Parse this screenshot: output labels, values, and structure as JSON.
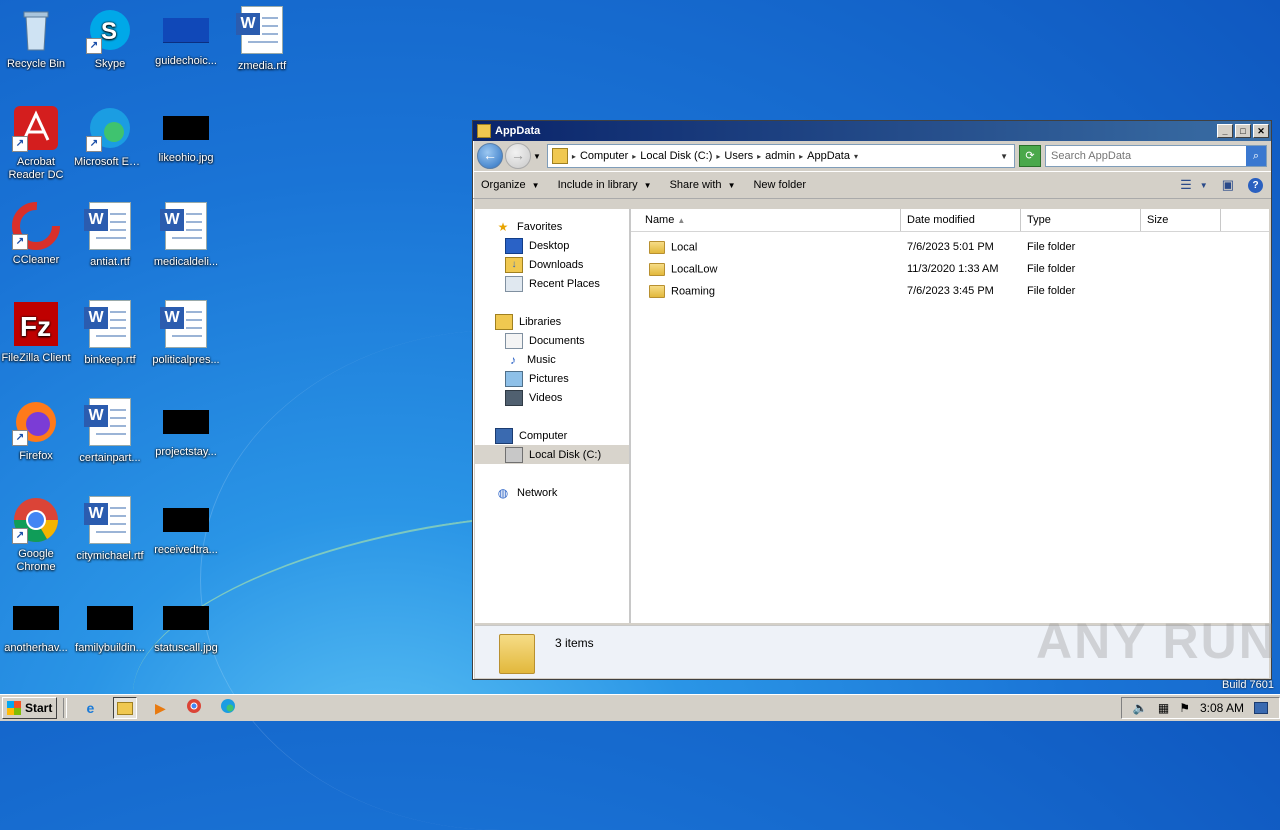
{
  "desktop": {
    "icons": [
      {
        "label": "Recycle Bin"
      },
      {
        "label": "Skype"
      },
      {
        "label": "guidechoic..."
      },
      {
        "label": "zmedia.rtf"
      },
      {
        "label": "Acrobat Reader DC"
      },
      {
        "label": "Microsoft Edge"
      },
      {
        "label": "likeohio.jpg"
      },
      {
        "label": "CCleaner"
      },
      {
        "label": "antiat.rtf"
      },
      {
        "label": "medicaldeli..."
      },
      {
        "label": "FileZilla Client"
      },
      {
        "label": "binkeep.rtf"
      },
      {
        "label": "politicalpres..."
      },
      {
        "label": "Firefox"
      },
      {
        "label": "certainpart..."
      },
      {
        "label": "projectstay..."
      },
      {
        "label": "Google Chrome"
      },
      {
        "label": "citymichael.rtf"
      },
      {
        "label": "receivedtra..."
      },
      {
        "label": "anotherhav..."
      },
      {
        "label": "familybuildin..."
      },
      {
        "label": "statuscall.jpg"
      }
    ]
  },
  "window": {
    "title": "AppData",
    "breadcrumb": [
      "Computer",
      "Local Disk (C:)",
      "Users",
      "admin",
      "AppData"
    ],
    "search_placeholder": "Search AppData",
    "toolbar": {
      "organize": "Organize",
      "include": "Include in library",
      "share": "Share with",
      "new_folder": "New folder"
    },
    "nav": {
      "favorites": "Favorites",
      "desktop": "Desktop",
      "downloads": "Downloads",
      "recent": "Recent Places",
      "libraries": "Libraries",
      "documents": "Documents",
      "music": "Music",
      "pictures": "Pictures",
      "videos": "Videos",
      "computer": "Computer",
      "local_disk": "Local Disk (C:)",
      "network": "Network"
    },
    "columns": [
      "Name",
      "Date modified",
      "Type",
      "Size"
    ],
    "files": [
      {
        "name": "Local",
        "date": "7/6/2023 5:01 PM",
        "type": "File folder",
        "size": ""
      },
      {
        "name": "LocalLow",
        "date": "11/3/2020 1:33 AM",
        "type": "File folder",
        "size": ""
      },
      {
        "name": "Roaming",
        "date": "7/6/2023 3:45 PM",
        "type": "File folder",
        "size": ""
      }
    ],
    "items_count": "3 items"
  },
  "watermark": "ANY RUN",
  "build": "Build 7601",
  "taskbar": {
    "start": "Start",
    "clock": "3:08 AM"
  }
}
